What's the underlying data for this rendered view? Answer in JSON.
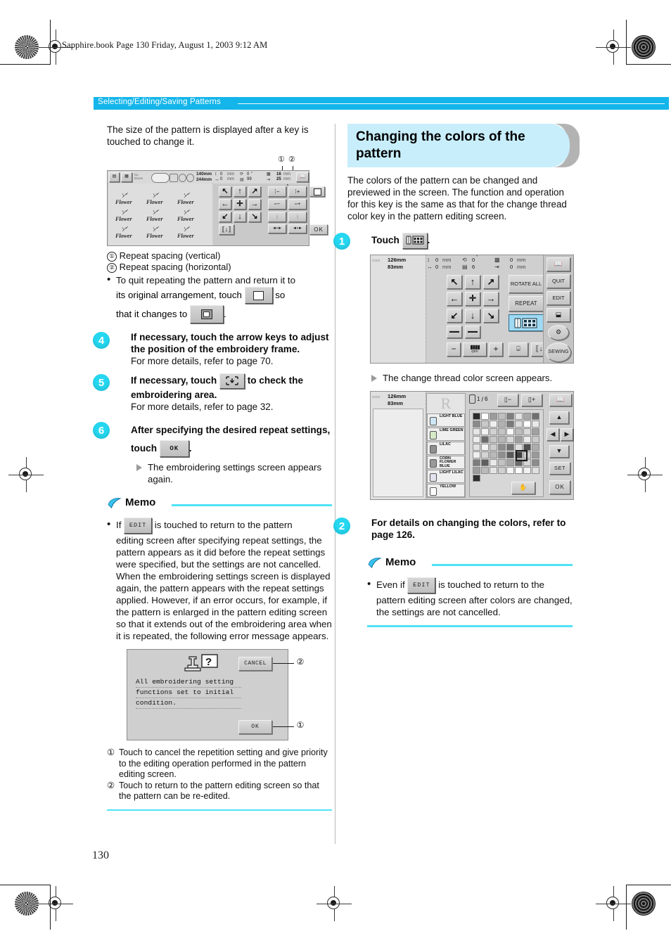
{
  "page": {
    "file_header": "Sapphire.book  Page 130  Friday, August 1, 2003  9:12 AM",
    "chapter": "Selecting/Editing/Saving Patterns",
    "page_number": "130",
    "accent_cyan": "#13b5ea",
    "step_circle_color": "#25d7f0",
    "banner_bg": "#c8eefb"
  },
  "left_column": {
    "intro": "The size of the pattern is displayed after a key is touched to change it.",
    "callouts": {
      "one": "①",
      "two": "②"
    },
    "legend": [
      {
        "marker": "①",
        "text": "Repeat spacing (vertical)"
      },
      {
        "marker": "②",
        "text": "Repeat spacing (horizontal)"
      }
    ],
    "bullet_quit": {
      "part1": "To quit repeating the pattern and return it to",
      "part2": "its original arrangement, touch",
      "part3": "so",
      "part4": "that it changes to",
      "part5": "."
    },
    "steps": [
      {
        "number": "4",
        "title": "If necessary, touch the arrow keys to adjust the position of the embroidery frame.",
        "body": "For more details, refer to page 70."
      },
      {
        "number": "5",
        "title_a": "If necessary, touch",
        "title_b": "to check the embroidering area.",
        "body": "For more details, refer to page 32."
      },
      {
        "number": "6",
        "title_a": "After specifying the desired repeat settings, touch",
        "key_label": "OK",
        "title_b": ".",
        "result": "The embroidering settings screen appears again."
      }
    ],
    "memo": {
      "title": "Memo",
      "bullet_lead": "If",
      "key_label": "EDIT",
      "bullet_text": "is touched to return to the pattern editing screen after specifying repeat settings, the pattern appears as it did before the repeat settings were specified, but the settings are not cancelled. When the embroidering settings screen is displayed again, the pattern appears with the repeat settings applied. However, if an error occurs, for example, if the pattern is enlarged in the pattern editing screen so that it extends out of the embroidering area when it is repeated, the following error message appears."
    },
    "error_dialog": {
      "message_lines": [
        "All embroidering setting",
        "functions set to initial",
        "condition."
      ],
      "cancel_label": "CANCEL",
      "ok_label": "OK",
      "callout_cancel": "②",
      "callout_ok": "①"
    },
    "dialog_legend": [
      {
        "marker": "①",
        "text": "Touch to cancel the repetition setting and give priority to the editing operation performed in the pattern editing screen."
      },
      {
        "marker": "②",
        "text": "Touch to return to the pattern editing screen so that the pattern can be re-edited."
      }
    ],
    "lcd_repeat_screen": {
      "size_w": "140mm",
      "size_h": "244mm",
      "fields": [
        {
          "label": "vertical-offset",
          "value": "0",
          "unit": "mm"
        },
        {
          "label": "horizontal-offset",
          "value": "0",
          "unit": "mm"
        },
        {
          "label": "rotation",
          "value": "0",
          "unit": "°"
        },
        {
          "label": "density",
          "value": "99",
          "unit": ""
        },
        {
          "label": "repeat-spacing-vertical",
          "value": "16",
          "unit": "mm"
        },
        {
          "label": "repeat-spacing-horizontal",
          "value": "25",
          "unit": "mm"
        }
      ],
      "pattern_label": "Flower",
      "ok_label": "OK"
    }
  },
  "right_column": {
    "section_title": "Changing the colors of the pattern",
    "intro": "The colors of the pattern can be changed and previewed in the screen. The function and operation for this key is the same as that for the change thread color key in the pattern editing screen.",
    "steps": [
      {
        "number": "1",
        "title_a": "Touch",
        "title_b": ".",
        "result": "The change thread color screen appears."
      },
      {
        "number": "2",
        "title": "For details on changing the colors, refer to page 126."
      }
    ],
    "memo": {
      "title": "Memo",
      "bullet_lead": "Even if",
      "key_label": "EDIT",
      "bullet_text": "is touched to return to the pattern editing screen after colors are changed, the settings are not cancelled."
    },
    "lcd_settings_screen": {
      "size_w": "126mm",
      "size_h": "83mm",
      "fields": [
        {
          "label": "vertical-offset",
          "value": "0",
          "unit": "mm"
        },
        {
          "label": "horizontal-offset",
          "value": "0",
          "unit": "mm"
        },
        {
          "label": "rotation",
          "value": "0",
          "unit": "°"
        },
        {
          "label": "density",
          "value": "6",
          "unit": ""
        },
        {
          "label": "repeat-spacing-vertical",
          "value": "0",
          "unit": "mm"
        },
        {
          "label": "repeat-spacing-horizontal",
          "value": "0",
          "unit": "mm"
        }
      ],
      "buttons": {
        "rotate_all": "ROTATE ALL",
        "repeat": "REPEAT",
        "quit": "QUIT",
        "edit": "EDIT",
        "sewing": "SEWING",
        "rpm": "rpm",
        "minus": "−",
        "plus": "+"
      }
    },
    "lcd_thread_color_screen": {
      "size_w": "126mm",
      "size_h": "83mm",
      "counter_current": "1",
      "counter_total": "6",
      "minus_label": "−",
      "plus_label": "+",
      "set_label": "SET",
      "ok_label": "OK",
      "preview_letter": "R",
      "thread_list": [
        "LIGHT BLUE",
        "LIME GREEN",
        "LILAC",
        "CORN FLOWER BLUE",
        "LIGHT LILAC",
        "YELLOW"
      ],
      "palette_rows": 9,
      "palette_cols": 8,
      "selected_cell": {
        "row": 5,
        "col": 5
      }
    }
  }
}
